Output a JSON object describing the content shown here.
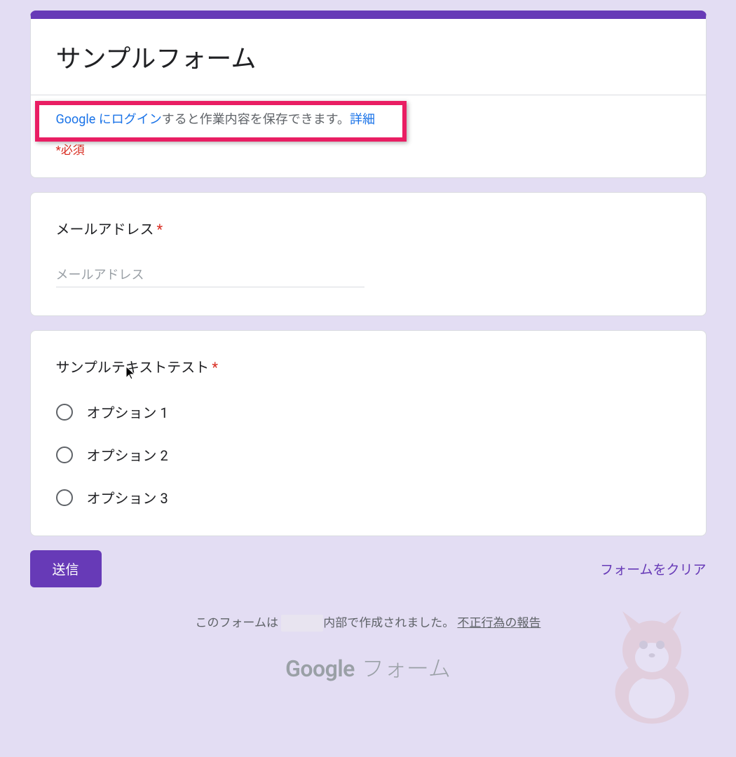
{
  "header": {
    "title": "サンプルフォーム",
    "login_link": "Google にログイン",
    "login_suffix": "すると作業内容を保存できます。",
    "detail_link": "詳細",
    "required_prefix": "*",
    "required_label": "必須"
  },
  "question_email": {
    "label": "メールアドレス",
    "placeholder": "メールアドレス"
  },
  "question_sample": {
    "label": "サンプルテキストテスト",
    "options": [
      "オプション 1",
      "オプション 2",
      "オプション 3"
    ]
  },
  "actions": {
    "submit": "送信",
    "clear": "フォームをクリア"
  },
  "footer": {
    "prefix": "このフォームは",
    "redacted": " ",
    "suffix": "内部で作成されました。",
    "abuse": "不正行為の報告",
    "google": "Google",
    "forms": "フォーム"
  },
  "colors": {
    "accent": "#673AB7",
    "link": "#1A73E8",
    "required": "#D93025",
    "highlight": "#E91E63",
    "background": "#E3DDF3"
  }
}
